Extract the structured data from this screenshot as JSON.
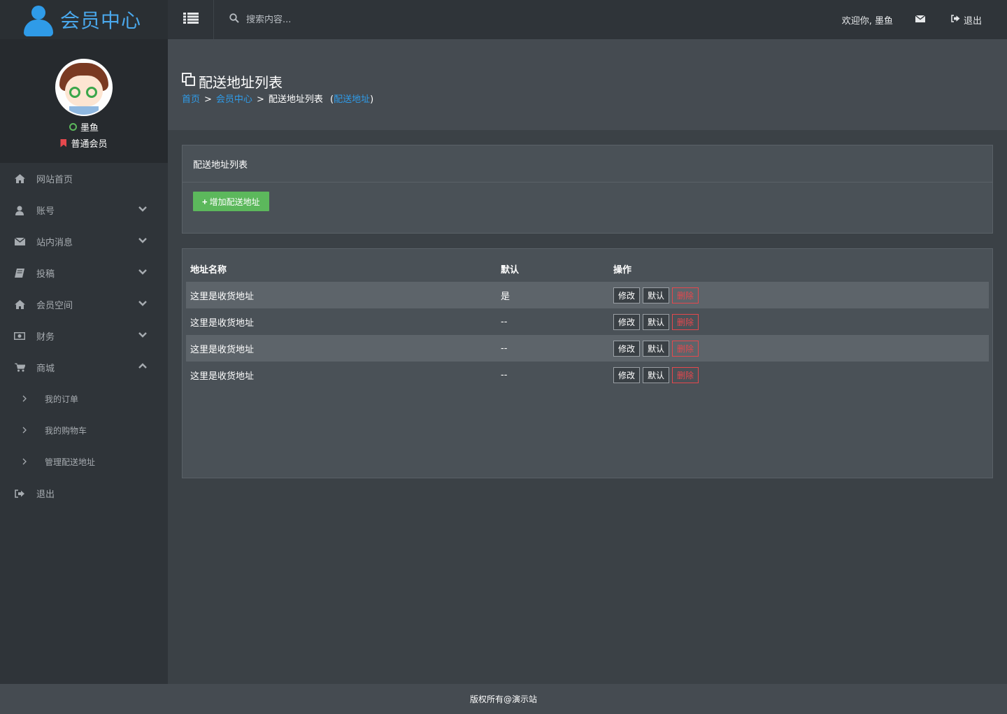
{
  "brand": {
    "title": "会员中心"
  },
  "user": {
    "name": "墨鱼",
    "level": "普通会员"
  },
  "topbar": {
    "search_placeholder": "搜索内容...",
    "welcome": "欢迎你, 墨鱼",
    "logout": "退出"
  },
  "sidebar": {
    "items": [
      {
        "label": "网站首页",
        "icon": "home-icon"
      },
      {
        "label": "账号",
        "icon": "user-icon"
      },
      {
        "label": "站内消息",
        "icon": "envelope-icon"
      },
      {
        "label": "投稿",
        "icon": "book-icon"
      },
      {
        "label": "会员空间",
        "icon": "home-icon"
      },
      {
        "label": "财务",
        "icon": "money-icon"
      },
      {
        "label": "商城",
        "icon": "cart-icon"
      },
      {
        "label": "退出",
        "icon": "sign-out-icon"
      }
    ],
    "shop_sub": [
      "我的订单",
      "我的购物车",
      "管理配送地址"
    ]
  },
  "page": {
    "title": "配送地址列表",
    "breadcrumb": {
      "home": "首页",
      "member": "会员中心",
      "current": "配送地址列表",
      "open": "(",
      "link": "配送地址",
      "close": ")",
      "sep": ">"
    }
  },
  "panel": {
    "title": "配送地址列表",
    "add_label": "增加配送地址"
  },
  "table": {
    "headers": [
      "地址名称",
      "默认",
      "操作"
    ],
    "rows": [
      {
        "name": "这里是收货地址",
        "default": "是"
      },
      {
        "name": "这里是收货地址",
        "default": "--"
      },
      {
        "name": "这里是收货地址",
        "default": "--"
      },
      {
        "name": "这里是收货地址",
        "default": "--"
      }
    ],
    "actions": {
      "edit": "修改",
      "default": "默认",
      "delete": "删除"
    }
  },
  "footer": {
    "text": "版权所有@演示站"
  },
  "colors": {
    "accent": "#2f9be8",
    "success": "#5cb85c",
    "danger": "#e5484d"
  }
}
